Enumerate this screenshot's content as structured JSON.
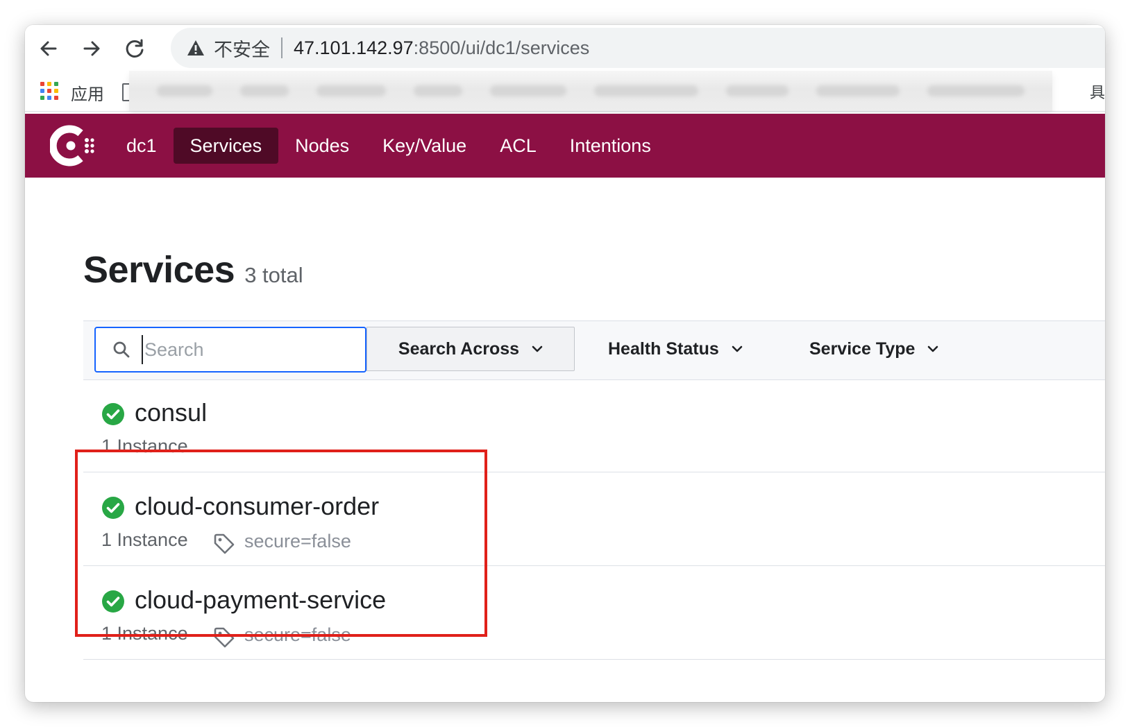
{
  "browser": {
    "insecure_label": "不安全",
    "url_host": "47.101.142.97",
    "url_path": ":8500/ui/dc1/services",
    "bookmarks_apps_label": "应用",
    "bookmarks_tail": "具"
  },
  "nav": {
    "datacenter": "dc1",
    "items": [
      {
        "label": "Services",
        "active": true
      },
      {
        "label": "Nodes",
        "active": false
      },
      {
        "label": "Key/Value",
        "active": false
      },
      {
        "label": "ACL",
        "active": false
      },
      {
        "label": "Intentions",
        "active": false
      }
    ],
    "brand_color": "#8c1044"
  },
  "page": {
    "title": "Services",
    "count": "3 total"
  },
  "filters": {
    "search_placeholder": "Search",
    "search_across": "Search Across",
    "health_status": "Health Status",
    "service_type": "Service Type"
  },
  "services": [
    {
      "name": "consul",
      "instances": "1 Instance",
      "tag": "",
      "status": "passing"
    },
    {
      "name": "cloud-consumer-order",
      "instances": "1 Instance",
      "tag": "secure=false",
      "status": "passing"
    },
    {
      "name": "cloud-payment-service",
      "instances": "1 Instance",
      "tag": "secure=false",
      "status": "passing"
    }
  ],
  "colors": {
    "passing": "#28a745",
    "highlight": "#e0201a",
    "focus": "#1563ff"
  }
}
